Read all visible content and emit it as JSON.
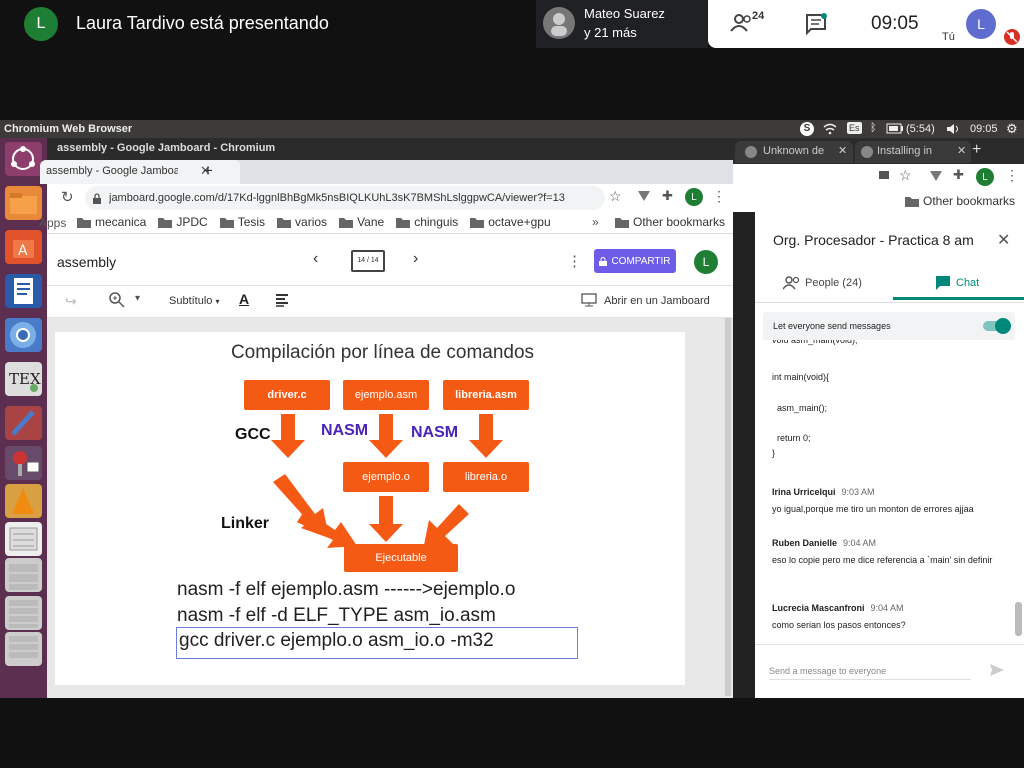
{
  "meet": {
    "presenter_initial": "L",
    "presenting_text": "Laura Tardivo está presentando",
    "participant_name": "Mateo Suarez",
    "participant_more": "y 21 más",
    "people_count": "24",
    "time": "09:05",
    "self_label": "Tú",
    "self_initial": "L"
  },
  "ubuntu": {
    "app_name": "Chromium Web Browser",
    "battery": "(5:54)",
    "time": "09:05",
    "kb": "Es",
    "skype": "S"
  },
  "chrome": {
    "window_title": "assembly - Google Jamboard - Chromium",
    "tab_title": "assembly - Google Jamboard",
    "url": "jamboard.google.com/d/17Kd-lggnlBhBgMk5nsBIQLKUhL3sK7BMShLslggpwCA/viewer?f=13",
    "avatar": "L",
    "bookmarks": [
      "Apps",
      "mecanica",
      "JPDC",
      "Tesis",
      "varios",
      "Vane",
      "chinguis",
      "octave+gpu"
    ],
    "other_bookmarks": "Other bookmarks",
    "more": "»"
  },
  "jamboard": {
    "title": "assembly",
    "frame_counter": "14 / 14",
    "share": "COMPARTIR",
    "avatar": "L",
    "tool_subtitle": "Subtítulo",
    "open_in": "Abrir en un Jamboard"
  },
  "slide": {
    "heading": "Compilación por línea de comandos",
    "boxes": [
      "driver.c",
      "ejemplo.asm",
      "libreria.asm",
      "ejemplo.o",
      "libreria.o",
      "Ejecutable"
    ],
    "labels": [
      "GCC",
      "NASM",
      "NASM",
      "Linker"
    ],
    "line1": "nasm -f elf ejemplo.asm ------>ejemplo.o",
    "line2": "nasm -f elf  -d ELF_TYPE asm_io.asm",
    "line3": "gcc driver.c ejemplo.o asm_io.o -m32"
  },
  "right_window": {
    "tab1": "Unknown de",
    "tab2": "Installing in",
    "avatar": "L",
    "other_bookmarks": "Other bookmarks"
  },
  "chat_panel": {
    "title": "Org. Procesador - Practica 8 am",
    "tab_people": "People (24)",
    "tab_chat": "Chat",
    "let_everyone": "Let everyone send messages",
    "code_lines": [
      "void asm_main(void);",
      "int main(void){",
      "asm_main();",
      "return 0;",
      "}"
    ],
    "messages": [
      {
        "name": "Irina Urricelqui",
        "time": "9:03 AM",
        "text": "yo igual,porque me tiro un monton de errores ajjaa"
      },
      {
        "name": "Ruben Danielle",
        "time": "9:04 AM",
        "text": "eso lo copie pero me dice referencia a `main' sin definir"
      },
      {
        "name": "Lucrecia Mascanfroni",
        "time": "9:04 AM",
        "text": "como serian los pasos entonces?"
      }
    ],
    "input_placeholder": "Send a message to everyone"
  },
  "colors": {
    "accent_orange": "#f55a14",
    "nasm_purple": "#4a24b8",
    "meet_green": "#00897b",
    "avatar_green": "#1e7e34",
    "avatar_blue": "#5f6dd0",
    "share_blue": "#6c5ce7"
  }
}
